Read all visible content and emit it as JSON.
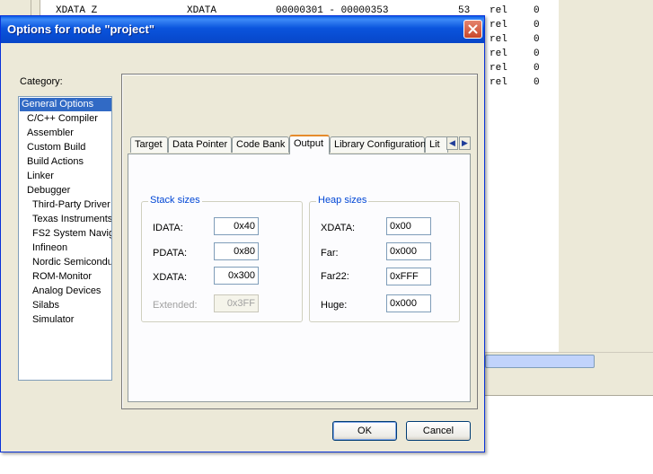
{
  "background": {
    "map_lines": [
      {
        "segment": "XDATA Z",
        "space": "XDATA",
        "range": "00000301 - 00000353",
        "size": "53",
        "type": "rel",
        "align": "0"
      },
      {
        "type": "rel",
        "align": "0"
      },
      {
        "type": "rel",
        "align": "0"
      },
      {
        "type": "rel",
        "align": "0"
      },
      {
        "type": "rel",
        "align": "0"
      },
      {
        "type": "rel",
        "align": "0"
      }
    ]
  },
  "dialog": {
    "title": "Options for node \"project\"",
    "category_label": "Category:",
    "categories": [
      "General Options",
      "C/C++ Compiler",
      "Assembler",
      "Custom Build",
      "Build Actions",
      "Linker",
      "Debugger",
      "Third-Party Driver",
      "Texas Instruments",
      "FS2 System Navig",
      "Infineon",
      "Nordic Semiconduc",
      "ROM-Monitor",
      "Analog Devices",
      "Silabs",
      "Simulator"
    ],
    "selected_category": "General Options",
    "tabs": [
      "Target",
      "Data Pointer",
      "Code Bank",
      "Output",
      "Library Configuration",
      "Lit"
    ],
    "active_tab": "Output",
    "stack": {
      "title": "Stack sizes",
      "idata_label": "IDATA:",
      "idata_value": "0x40",
      "pdata_label": "PDATA:",
      "pdata_value": "0x80",
      "xdata_label": "XDATA:",
      "xdata_value": "0x300",
      "extended_label": "Extended:",
      "extended_value": "0x3FF"
    },
    "heap": {
      "title": "Heap sizes",
      "xdata_label": "XDATA:",
      "xdata_value": "0x00",
      "far_label": "Far:",
      "far_value": "0x000",
      "far22_label": "Far22:",
      "far22_value": "0xFFF",
      "huge_label": "Huge:",
      "huge_value": "0x000"
    },
    "buttons": {
      "ok": "OK",
      "cancel": "Cancel"
    }
  },
  "icons": {
    "close": "close-icon",
    "tab_left": "chevron-left-icon",
    "tab_right": "chevron-right-icon"
  },
  "colors": {
    "titlebar": "#0a54dd",
    "close_button": "#c8472b",
    "selection": "#316ac5",
    "group_title": "#0046d5",
    "active_tab_accent": "#e68b2c"
  }
}
